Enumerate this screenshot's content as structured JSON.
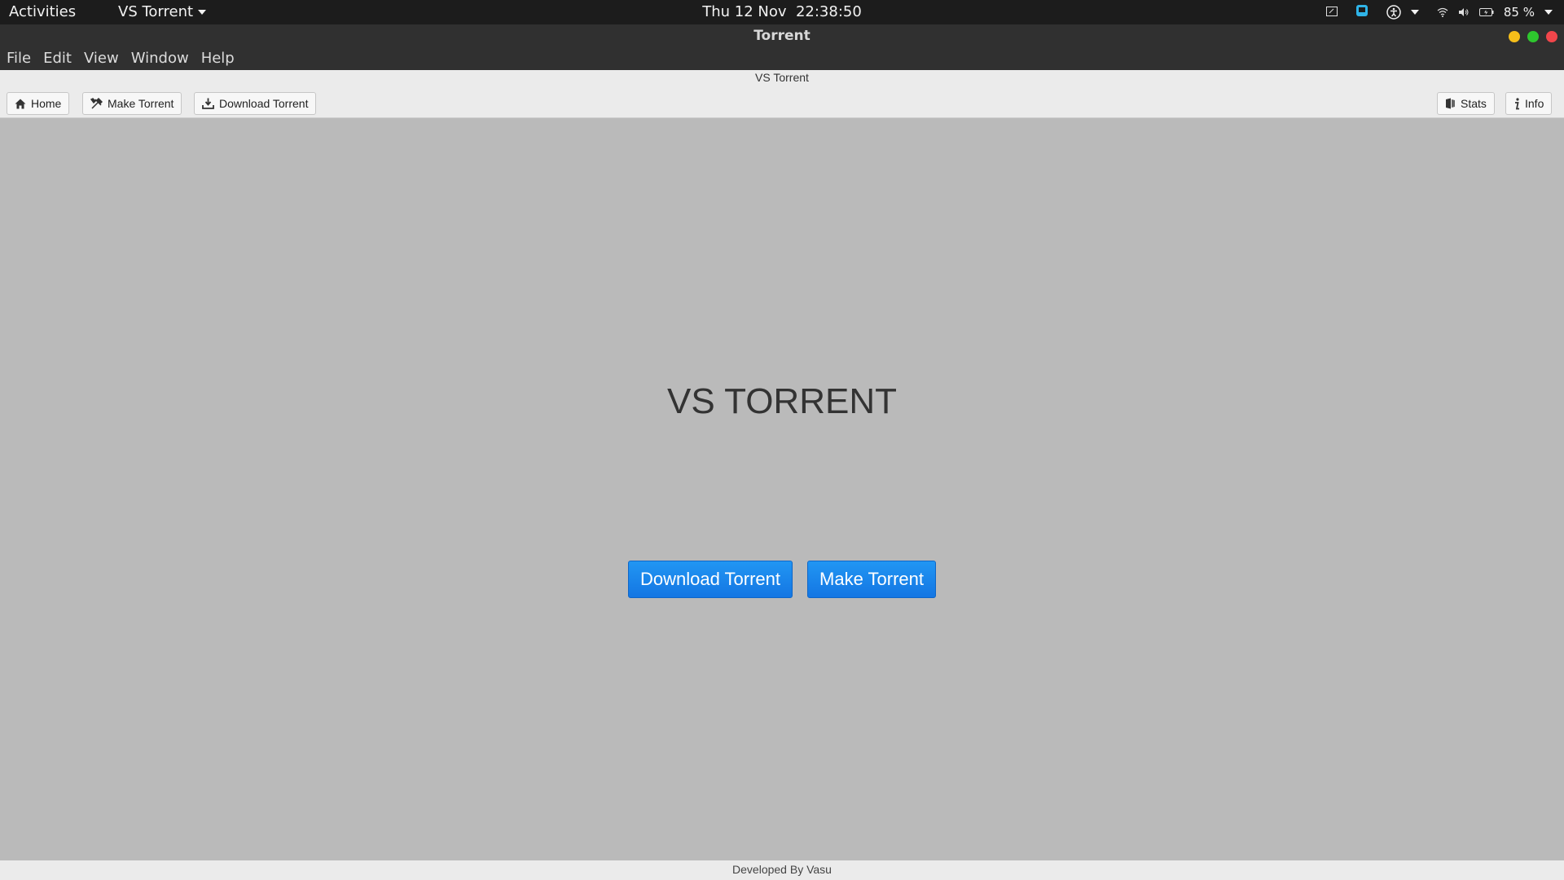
{
  "system_bar": {
    "activities": "Activities",
    "app_menu": "VS Torrent",
    "date": "Thu 12 Nov",
    "time": "22:38:50",
    "battery": "85 %"
  },
  "window": {
    "title": "Torrent"
  },
  "menubar": {
    "items": [
      "File",
      "Edit",
      "View",
      "Window",
      "Help"
    ]
  },
  "app": {
    "title": "VS Torrent",
    "toolbar": {
      "home": "Home",
      "make_torrent": "Make Torrent",
      "download_torrent": "Download Torrent",
      "stats": "Stats",
      "info": "Info"
    },
    "heading": "VS TORRENT",
    "actions": {
      "download": "Download Torrent",
      "make": "Make Torrent"
    },
    "footer": "Developed By Vasu"
  },
  "colors": {
    "accent_button": "#1f8df0",
    "background": "#bababa"
  }
}
